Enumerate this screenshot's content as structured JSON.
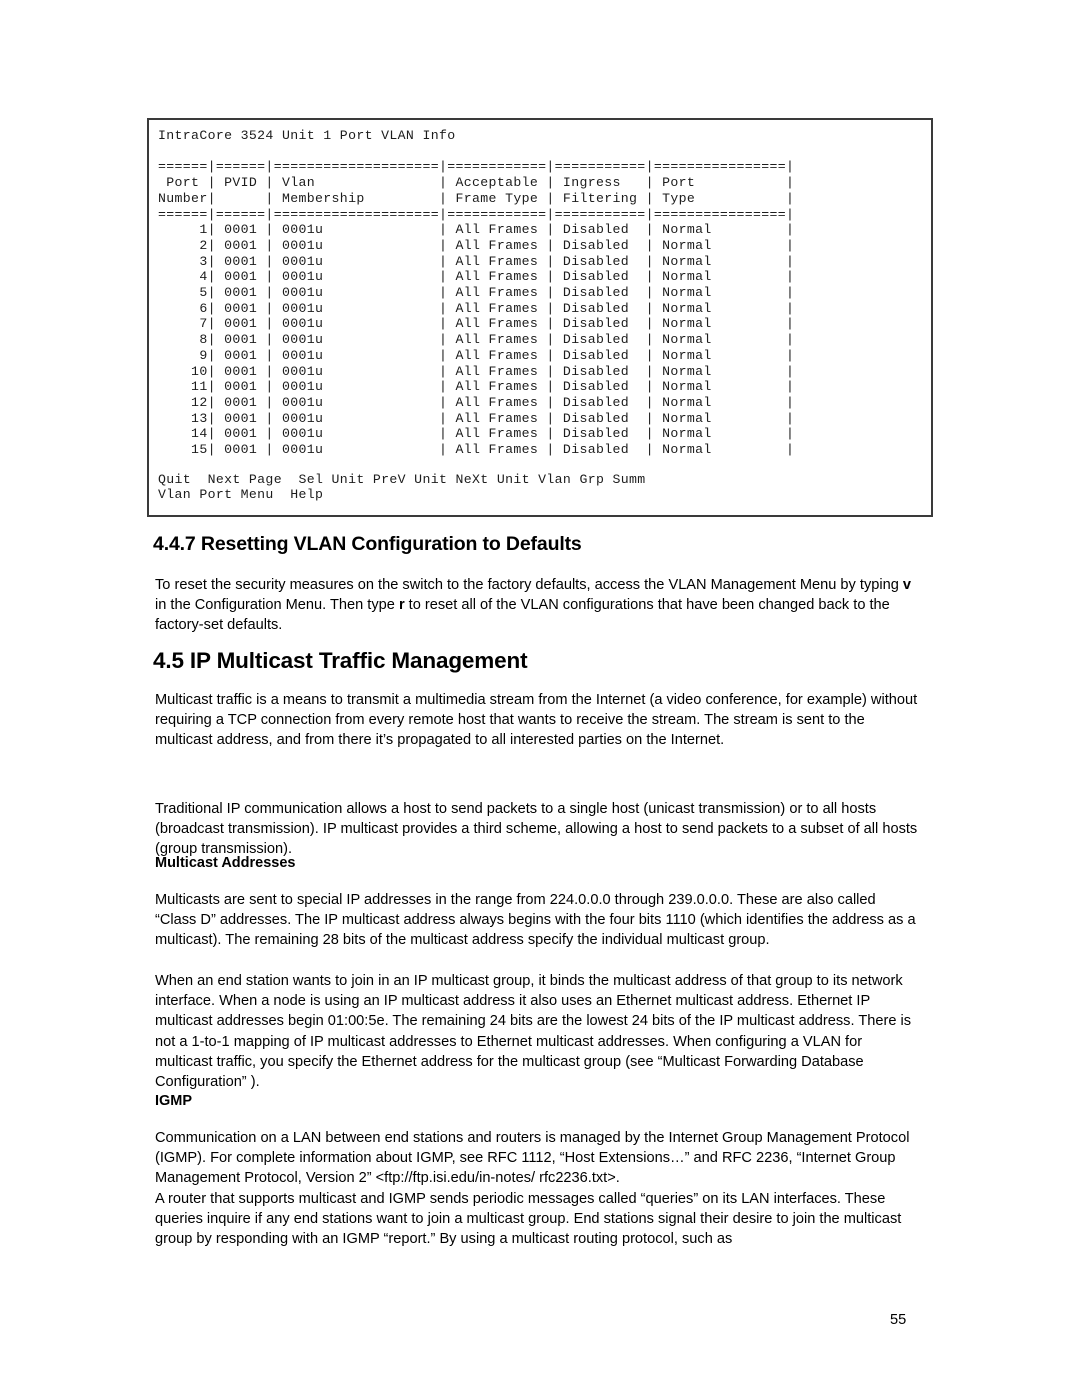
{
  "document": {
    "page_number": "55"
  },
  "terminal": {
    "title": "IntraCore 3524 Unit 1 Port VLAN Info",
    "separator": "======|======|====================|============|===========|================|",
    "header_rows": [
      " Port | PVID | Vlan               | Acceptable | Ingress   | Port           |",
      "Number|      | Membership         | Frame Type | Filtering | Type           |"
    ],
    "columns": [
      "Port Number",
      "PVID",
      "Vlan Membership",
      "Acceptable Frame Type",
      "Ingress Filtering",
      "Port Type"
    ],
    "rows": [
      {
        "port": "1",
        "pvid": "0001",
        "membership": "0001u",
        "frame_type": "All Frames",
        "ingress_filtering": "Disabled",
        "port_type": "Normal"
      },
      {
        "port": "2",
        "pvid": "0001",
        "membership": "0001u",
        "frame_type": "All Frames",
        "ingress_filtering": "Disabled",
        "port_type": "Normal"
      },
      {
        "port": "3",
        "pvid": "0001",
        "membership": "0001u",
        "frame_type": "All Frames",
        "ingress_filtering": "Disabled",
        "port_type": "Normal"
      },
      {
        "port": "4",
        "pvid": "0001",
        "membership": "0001u",
        "frame_type": "All Frames",
        "ingress_filtering": "Disabled",
        "port_type": "Normal"
      },
      {
        "port": "5",
        "pvid": "0001",
        "membership": "0001u",
        "frame_type": "All Frames",
        "ingress_filtering": "Disabled",
        "port_type": "Normal"
      },
      {
        "port": "6",
        "pvid": "0001",
        "membership": "0001u",
        "frame_type": "All Frames",
        "ingress_filtering": "Disabled",
        "port_type": "Normal"
      },
      {
        "port": "7",
        "pvid": "0001",
        "membership": "0001u",
        "frame_type": "All Frames",
        "ingress_filtering": "Disabled",
        "port_type": "Normal"
      },
      {
        "port": "8",
        "pvid": "0001",
        "membership": "0001u",
        "frame_type": "All Frames",
        "ingress_filtering": "Disabled",
        "port_type": "Normal"
      },
      {
        "port": "9",
        "pvid": "0001",
        "membership": "0001u",
        "frame_type": "All Frames",
        "ingress_filtering": "Disabled",
        "port_type": "Normal"
      },
      {
        "port": "10",
        "pvid": "0001",
        "membership": "0001u",
        "frame_type": "All Frames",
        "ingress_filtering": "Disabled",
        "port_type": "Normal"
      },
      {
        "port": "11",
        "pvid": "0001",
        "membership": "0001u",
        "frame_type": "All Frames",
        "ingress_filtering": "Disabled",
        "port_type": "Normal"
      },
      {
        "port": "12",
        "pvid": "0001",
        "membership": "0001u",
        "frame_type": "All Frames",
        "ingress_filtering": "Disabled",
        "port_type": "Normal"
      },
      {
        "port": "13",
        "pvid": "0001",
        "membership": "0001u",
        "frame_type": "All Frames",
        "ingress_filtering": "Disabled",
        "port_type": "Normal"
      },
      {
        "port": "14",
        "pvid": "0001",
        "membership": "0001u",
        "frame_type": "All Frames",
        "ingress_filtering": "Disabled",
        "port_type": "Normal"
      },
      {
        "port": "15",
        "pvid": "0001",
        "membership": "0001u",
        "frame_type": "All Frames",
        "ingress_filtering": "Disabled",
        "port_type": "Normal"
      }
    ],
    "menu_line_1": "Quit  Next Page  Sel Unit PreV Unit NeXt Unit Vlan Grp Summ",
    "menu_line_2": "Vlan Port Menu  Help",
    "menu_items": [
      "Quit",
      "Next Page",
      "Sel Unit",
      "PreV Unit",
      "NeXt Unit",
      "Vlan Grp Summ",
      "Vlan Port Menu",
      "Help"
    ]
  },
  "sections": {
    "resetting_vlan": {
      "heading": "4.4.7 Resetting VLAN Configuration to Defaults",
      "para_part_1": "To reset the security measures on the switch to the factory defaults, access the VLAN Management Menu by typing ",
      "key_v": "v",
      "para_part_2": " in the Configuration Menu.  Then type ",
      "key_r": "r",
      "para_part_3": " to reset all of the VLAN configurations that have been changed back to the factory-set defaults."
    },
    "ip_multicast": {
      "heading": "4.5 IP Multicast Traffic Management",
      "para_1": "Multicast traffic is a means to transmit a multimedia stream from the Internet (a video conference, for example) without requiring a TCP connection from every remote host that wants to receive the stream. The stream is sent to the multicast address, and from there it’s propagated to all interested parties on the Internet.",
      "para_2": "Traditional IP communication allows a host to send packets to a single host (unicast transmission) or to all hosts (broadcast transmission). IP multicast provides a third scheme, allowing a host to send packets to a subset of all hosts (group transmission)."
    },
    "multicast_addresses": {
      "heading": "Multicast Addresses",
      "para_1": "Multicasts are sent to special IP addresses in the range from 224.0.0.0 through 239.0.0.0. These are also called “Class D” addresses. The IP multicast address always begins with the four bits 1110 (which identifies the address as a multicast). The remaining 28 bits of the multicast address specify the individual multicast group.",
      "para_2": "When an end station wants to join in an IP multicast group, it binds the multicast address of that group to its network interface. When a node is using an IP multicast address it also uses an Ethernet multicast address. Ethernet IP multicast addresses begin 01:00:5e. The remaining 24 bits are the lowest 24 bits of the IP multicast address. There is not a 1-to-1 mapping of IP multicast addresses to Ethernet multicast addresses. When configuring a VLAN for multicast traffic, you specify the Ethernet address for the multicast group (see “Multicast Forwarding Database Configuration” )."
    },
    "igmp": {
      "heading": "IGMP",
      "para_1": "Communication on a LAN between end stations and routers is managed by the Internet Group Management Protocol (IGMP). For complete information about IGMP, see RFC 1112, “Host Extensions…” and RFC 2236, “Internet Group Management Protocol, Version 2” <ftp://ftp.isi.edu/in-notes/ rfc2236.txt>.",
      "para_2": "A router that supports multicast and IGMP sends periodic messages called “queries” on its LAN interfaces. These queries inquire if any end stations want to join a multicast group. End stations signal their desire to join the multicast group by responding with an IGMP “report.” By using a multicast routing protocol, such as"
    }
  }
}
